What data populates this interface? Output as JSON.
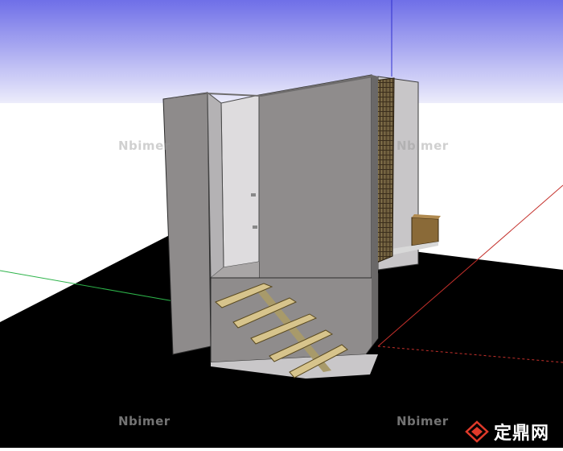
{
  "watermarks": {
    "top_left": "Nbimer",
    "top_right": "Nbimer",
    "bottom_left": "Nbimer",
    "bottom_right": "Nbimer"
  },
  "logo": {
    "text": "定鼎网",
    "icon": "logo-icon"
  },
  "colors": {
    "sky_top": "#6f6fe8",
    "sky_bottom": "#ececfb",
    "ground": "#000000",
    "axis_red": "#c4302b",
    "axis_green": "#2db34a",
    "axis_blue": "#3030d0",
    "wall": "#8f8c8c",
    "step": "#d7c48c",
    "slats": "#5a4a30"
  }
}
